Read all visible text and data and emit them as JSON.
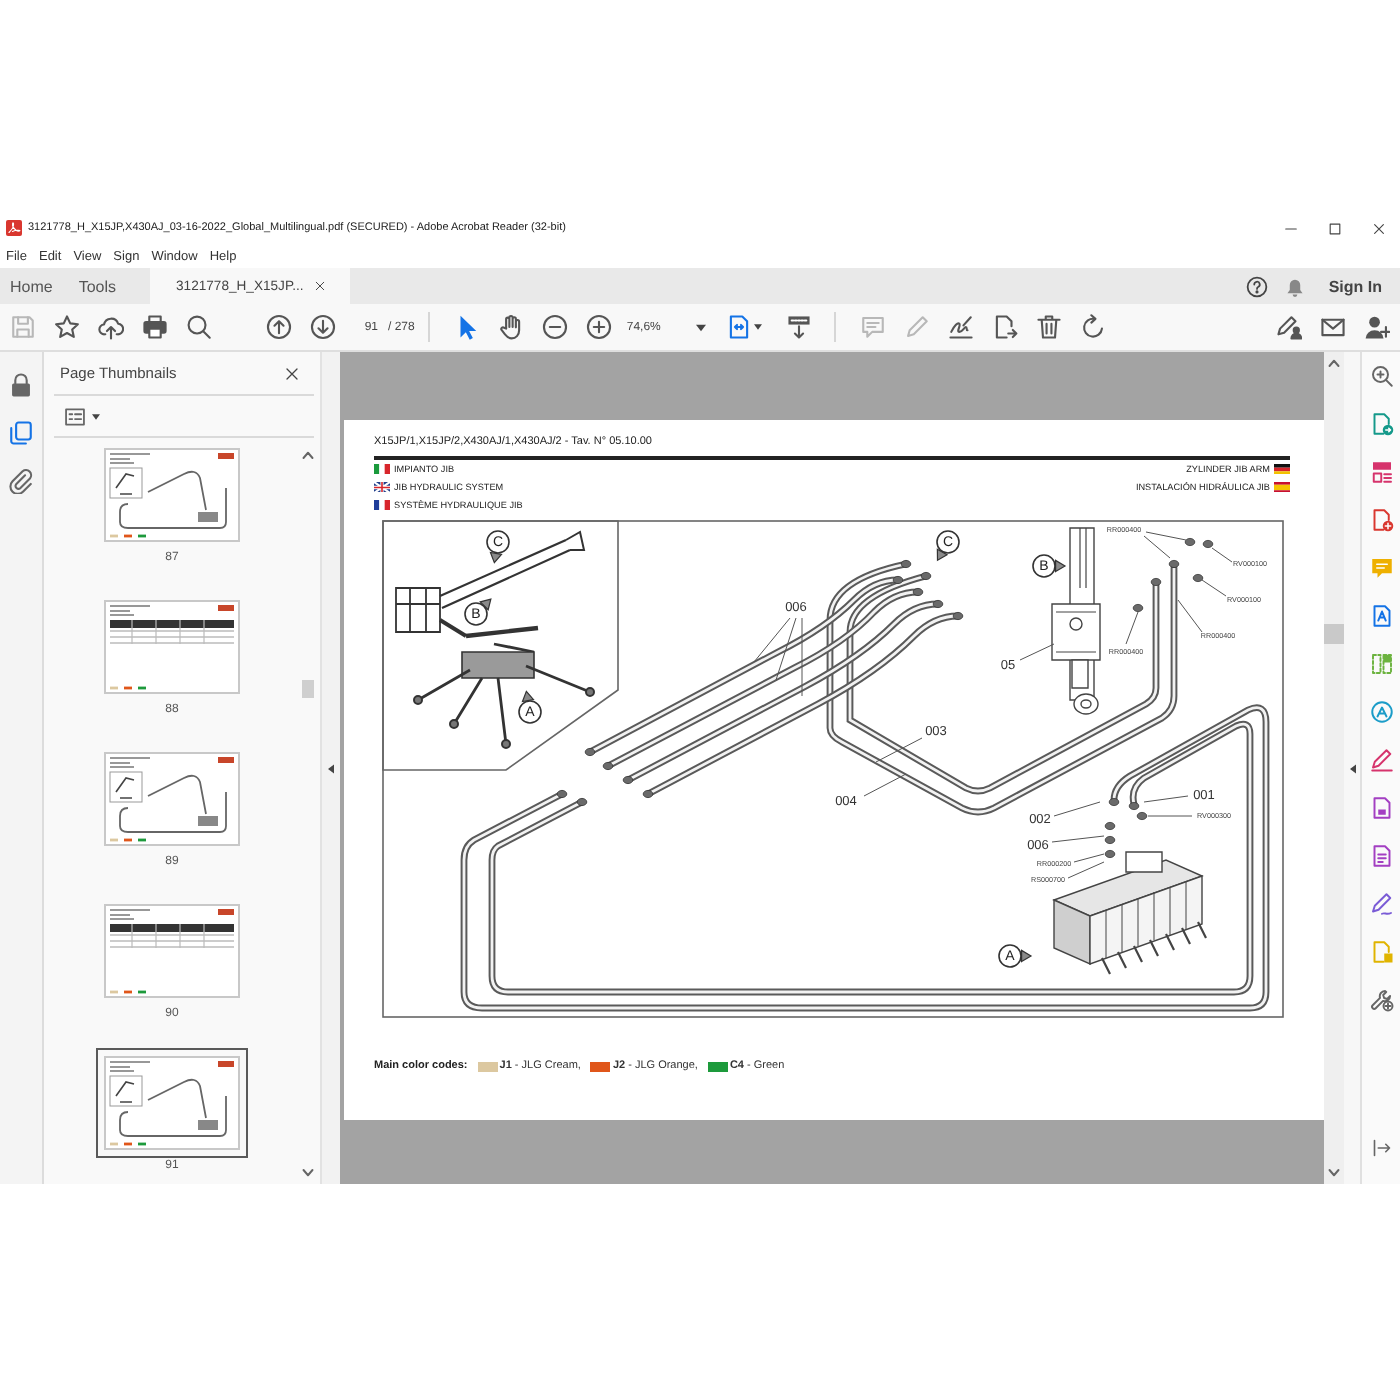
{
  "window": {
    "title": "3121778_H_X15JP,X430AJ_03-16-2022_Global_Multilingual.pdf (SECURED) - Adobe Acrobat Reader (32-bit)",
    "menu": [
      "File",
      "Edit",
      "View",
      "Sign",
      "Window",
      "Help"
    ]
  },
  "tabs": [
    {
      "label": "Home",
      "kind": "view",
      "selected": false
    },
    {
      "label": "Tools",
      "kind": "view",
      "selected": false
    },
    {
      "label": "3121778_H_X15JP...",
      "kind": "document",
      "selected": true
    }
  ],
  "account": {
    "sign_in": "Sign In"
  },
  "toolbar": {
    "page_number": "91",
    "page_count": "/ 278",
    "zoom": "74,6%"
  },
  "sidebar": {
    "panels": [
      {
        "kind": "lock",
        "selected": false
      },
      {
        "kind": "pages",
        "selected": true
      },
      {
        "kind": "attachments",
        "selected": false
      }
    ]
  },
  "thumbnails": {
    "title": "Page Thumbnails",
    "pages": [
      {
        "label": "87",
        "kind": "diagram",
        "selected": false
      },
      {
        "label": "88",
        "kind": "table",
        "selected": false
      },
      {
        "label": "89",
        "kind": "diagram",
        "selected": false
      },
      {
        "label": "90",
        "kind": "table",
        "selected": false
      },
      {
        "label": "91",
        "kind": "diagram",
        "selected": true
      }
    ]
  },
  "document": {
    "header": "X15JP/1,X15JP/2,X430AJ/1,X430AJ/2 - Tav. N° 05.10.00",
    "titles_left": [
      {
        "kind": "italian",
        "text": "IMPIANTO JIB"
      },
      {
        "kind": "english",
        "text": "JIB HYDRAULIC SYSTEM"
      },
      {
        "kind": "french",
        "text": "SYSTÈME HYDRAULIQUE JIB"
      }
    ],
    "titles_right": [
      {
        "kind": "german",
        "text": "ZYLINDER JIB ARM"
      },
      {
        "kind": "spanish",
        "text": "INSTALACIÓN HIDRÁULICA JIB"
      }
    ],
    "diagram": {
      "inset_callouts": [
        "C",
        "B",
        "A"
      ],
      "callouts": [
        "C",
        "B",
        "A"
      ],
      "item_numbers": [
        "006",
        "05",
        "003",
        "004",
        "001",
        "002",
        "006"
      ],
      "part_codes": [
        "RR000400",
        "RV000100",
        "RV000100",
        "RR000400",
        "RR000400",
        "RV000300",
        "RR000200",
        "RS000700"
      ]
    },
    "color_codes": {
      "label": "Main color codes:",
      "items": [
        {
          "text": "**J1** - JLG Cream,",
          "color": "#dcc8a0"
        },
        {
          "text": "**J2** - JLG Orange,",
          "color": "#e0561a"
        },
        {
          "text": "**C4** - Green",
          "color": "#1d9a3c"
        }
      ]
    }
  }
}
